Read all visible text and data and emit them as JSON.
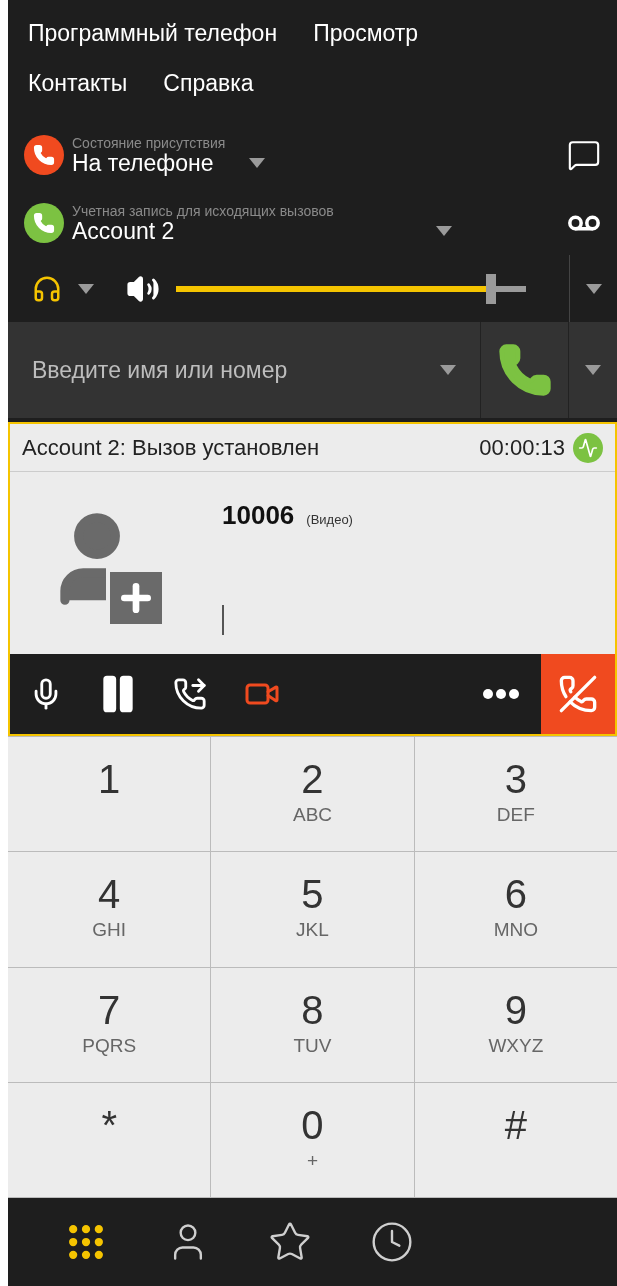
{
  "menu": [
    {
      "label": "Программный телефон"
    },
    {
      "label": "Просмотр"
    },
    {
      "label": "Контакты"
    },
    {
      "label": "Справка"
    }
  ],
  "presence": {
    "label": "Состояние присутствия",
    "value": "На телефоне"
  },
  "account": {
    "label": "Учетная запись для исходящих вызовов",
    "value": "Account 2"
  },
  "volume": {
    "level": 0.9
  },
  "dial": {
    "placeholder": "Введите имя или номер"
  },
  "call": {
    "status": "Account 2: Вызов установлен",
    "timer": "00:00:13",
    "number": "10006",
    "media": "(Видео)"
  },
  "keys": [
    {
      "digit": "1"
    },
    {
      "digit": "2",
      "letters": "ABC"
    },
    {
      "digit": "3",
      "letters": "DEF"
    },
    {
      "digit": "4",
      "letters": "GHI"
    },
    {
      "digit": "5",
      "letters": "JKL"
    },
    {
      "digit": "6",
      "letters": "MNO"
    },
    {
      "digit": "7",
      "letters": "PQRS"
    },
    {
      "digit": "8",
      "letters": "TUV"
    },
    {
      "digit": "9",
      "letters": "WXYZ"
    },
    {
      "digit": "*"
    },
    {
      "digit": "0",
      "letters": "+"
    },
    {
      "digit": "#"
    }
  ],
  "nav": [
    {
      "kind": "dialpad",
      "selected": true
    },
    {
      "kind": "contacts",
      "selected": false
    },
    {
      "kind": "favorites",
      "selected": false
    },
    {
      "kind": "history",
      "selected": false
    }
  ]
}
